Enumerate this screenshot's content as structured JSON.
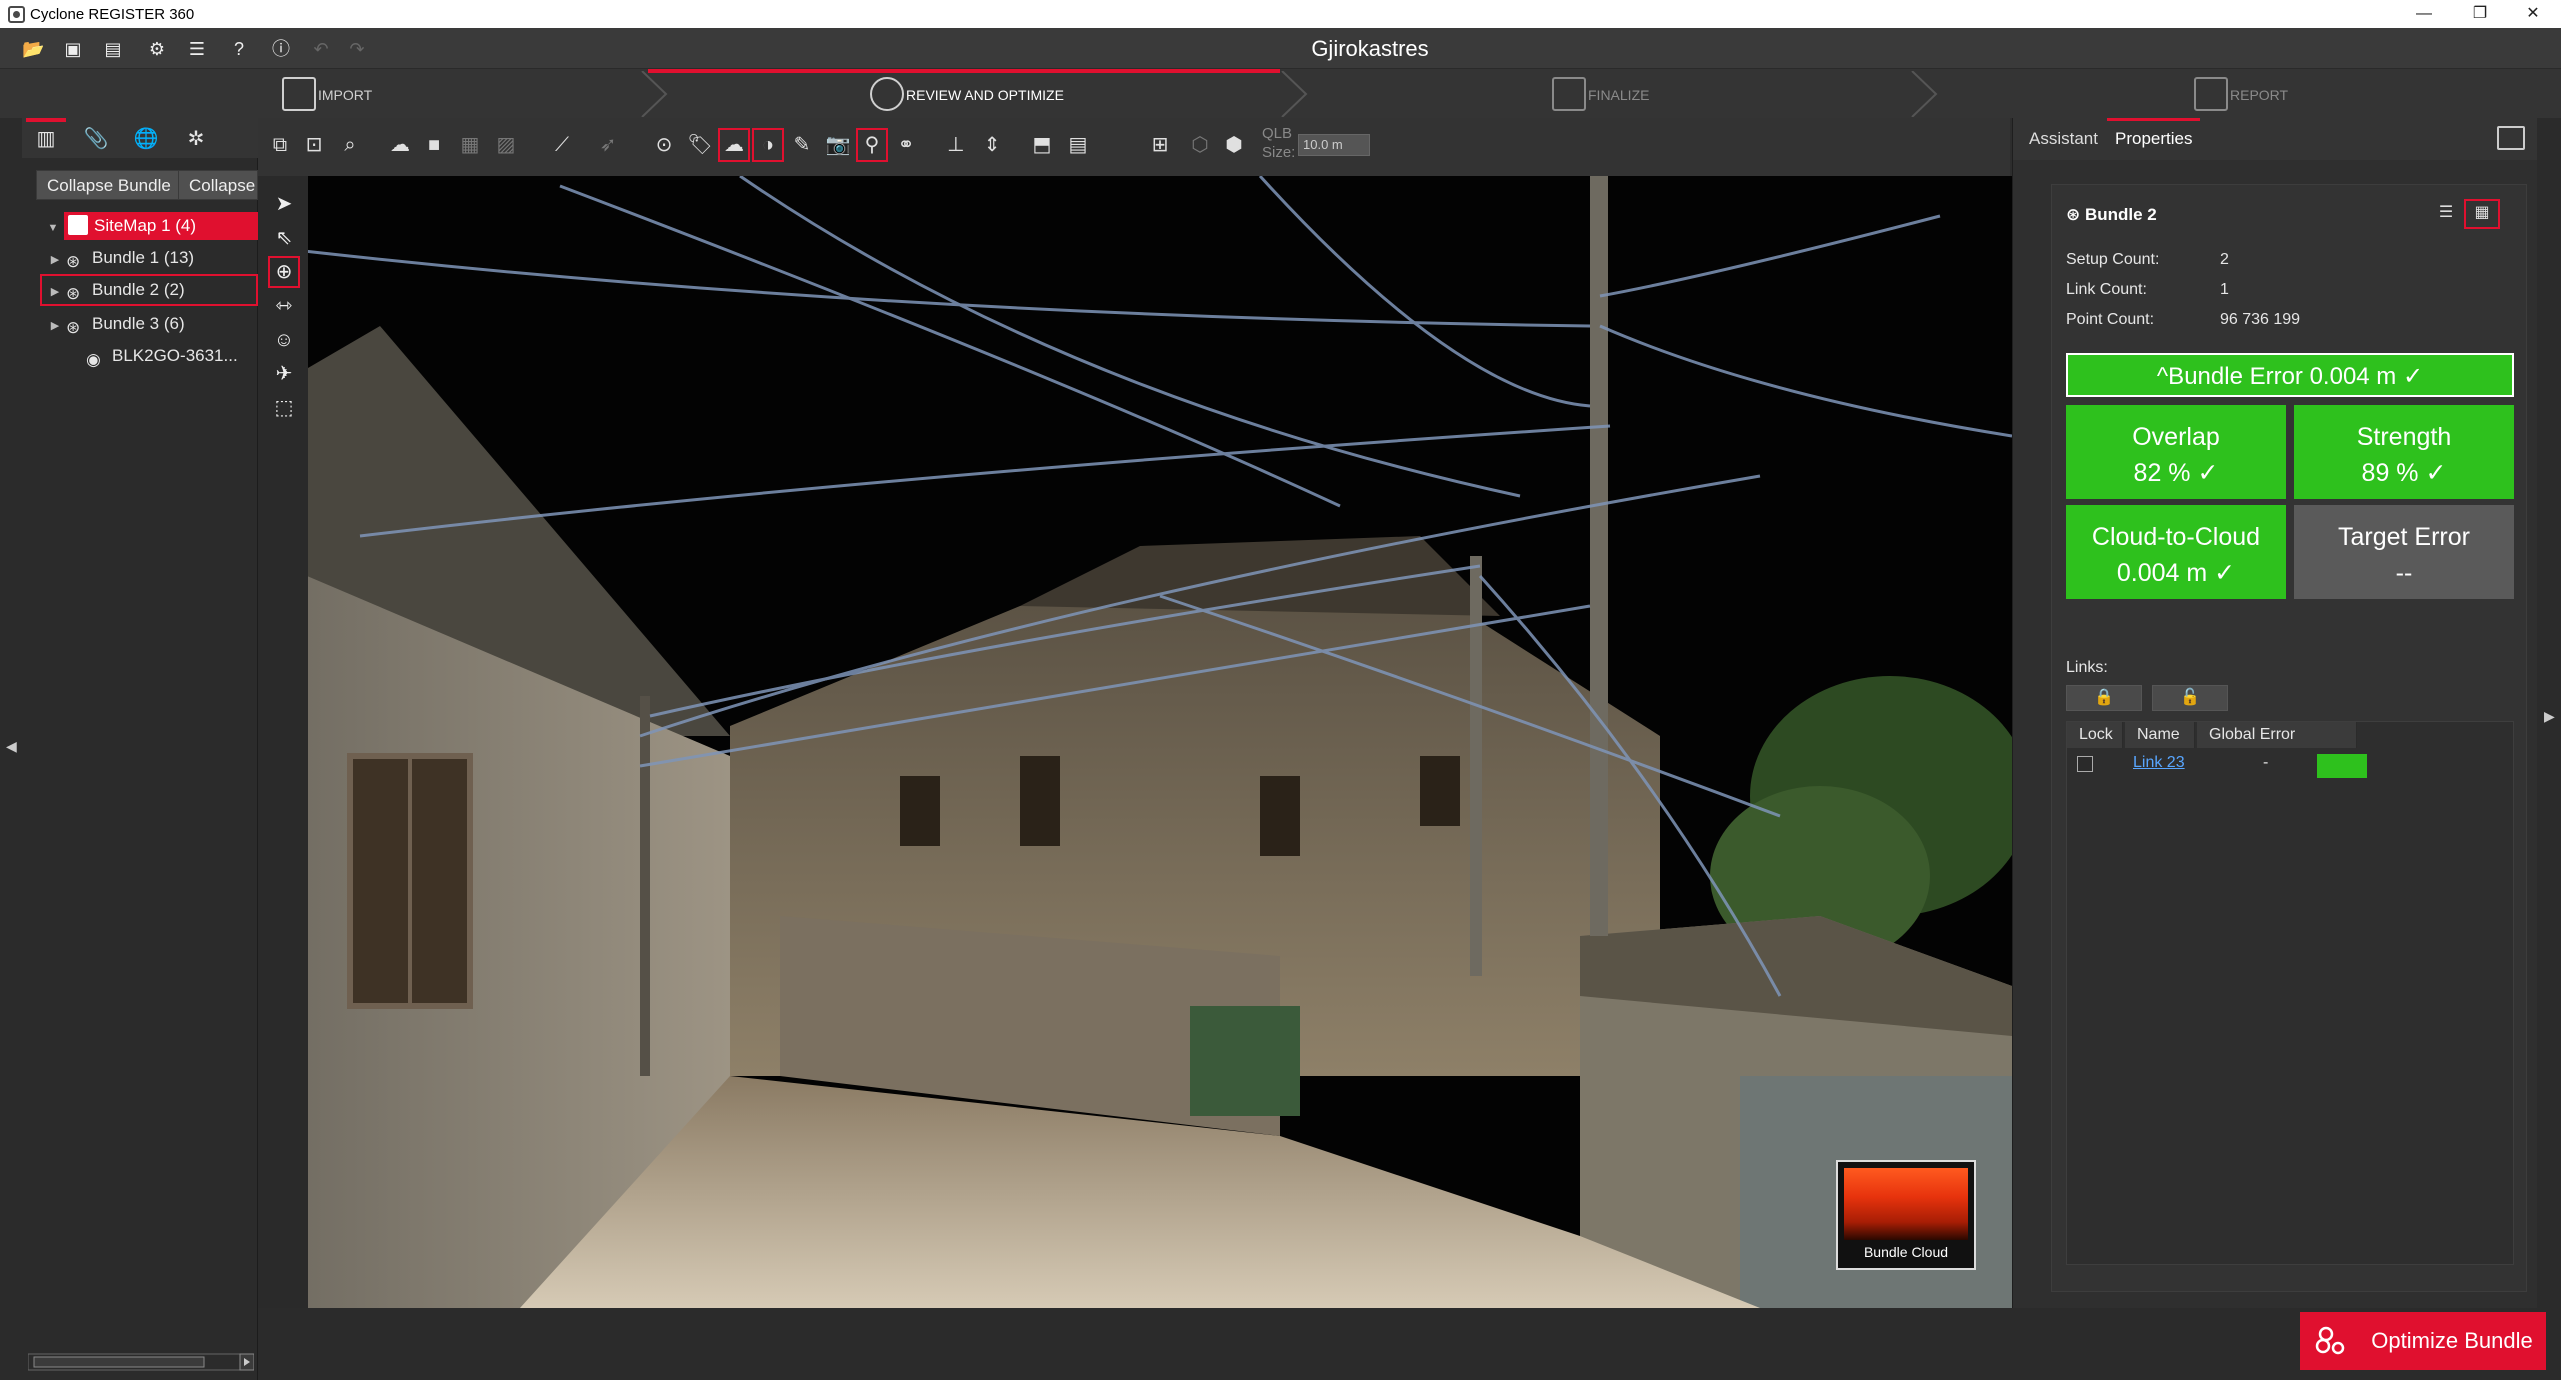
{
  "window": {
    "title": "Cyclone REGISTER 360"
  },
  "project": {
    "title": "Gjirokastres"
  },
  "steps": [
    {
      "label": "IMPORT",
      "icon": "import-icon"
    },
    {
      "label": "REVIEW AND OPTIMIZE",
      "icon": "review-icon"
    },
    {
      "label": "FINALIZE",
      "icon": "finalize-icon"
    },
    {
      "label": "REPORT",
      "icon": "report-icon"
    }
  ],
  "left_panel": {
    "collapse_bundle_label": "Collapse Bundle",
    "collapse_label": "Collapse",
    "tree": [
      {
        "label": "SiteMap 1 (4)",
        "icon": "sitemap-icon"
      },
      {
        "label": "Bundle 1 (13)",
        "icon": "bundle-icon"
      },
      {
        "label": "Bundle 2 (2)",
        "icon": "bundle-icon"
      },
      {
        "label": "Bundle 3 (6)",
        "icon": "bundle-icon"
      },
      {
        "label": "BLK2GO-3631...",
        "icon": "setup-icon"
      }
    ]
  },
  "viewport_toolbar": {
    "qlb_label_1": "QLB",
    "qlb_label_2": "Size:",
    "qlb_size_value": "10.0 m"
  },
  "viewport": {
    "thumbnail_caption": "Bundle Cloud"
  },
  "right_panel": {
    "tabs": [
      "Assistant",
      "Properties"
    ],
    "bundle_title": "Bundle 2",
    "setup_count_label": "Setup Count:",
    "setup_count": "2",
    "link_count_label": "Link Count:",
    "link_count": "1",
    "point_count_label": "Point Count:",
    "point_count": "96 736 199",
    "bundle_error": "^Bundle Error 0.004 m   ✓",
    "metrics": {
      "overlap_title": "Overlap",
      "overlap_value": "82 %   ✓",
      "strength_title": "Strength",
      "strength_value": "89 %   ✓",
      "c2c_title": "Cloud-to-Cloud",
      "c2c_value": "0.004 m   ✓",
      "target_title": "Target Error",
      "target_value": "--"
    },
    "status_colors": {
      "good": "#2ec11d",
      "neutral": "#5a5a5a",
      "accent": "#e0102f"
    },
    "links_label": "Links:",
    "links_columns": [
      "Lock",
      "Name",
      "Global Error"
    ],
    "links_rows": [
      {
        "name": "Link 23",
        "global_error": "-"
      }
    ]
  },
  "optimize_button_label": "Optimize Bundle"
}
